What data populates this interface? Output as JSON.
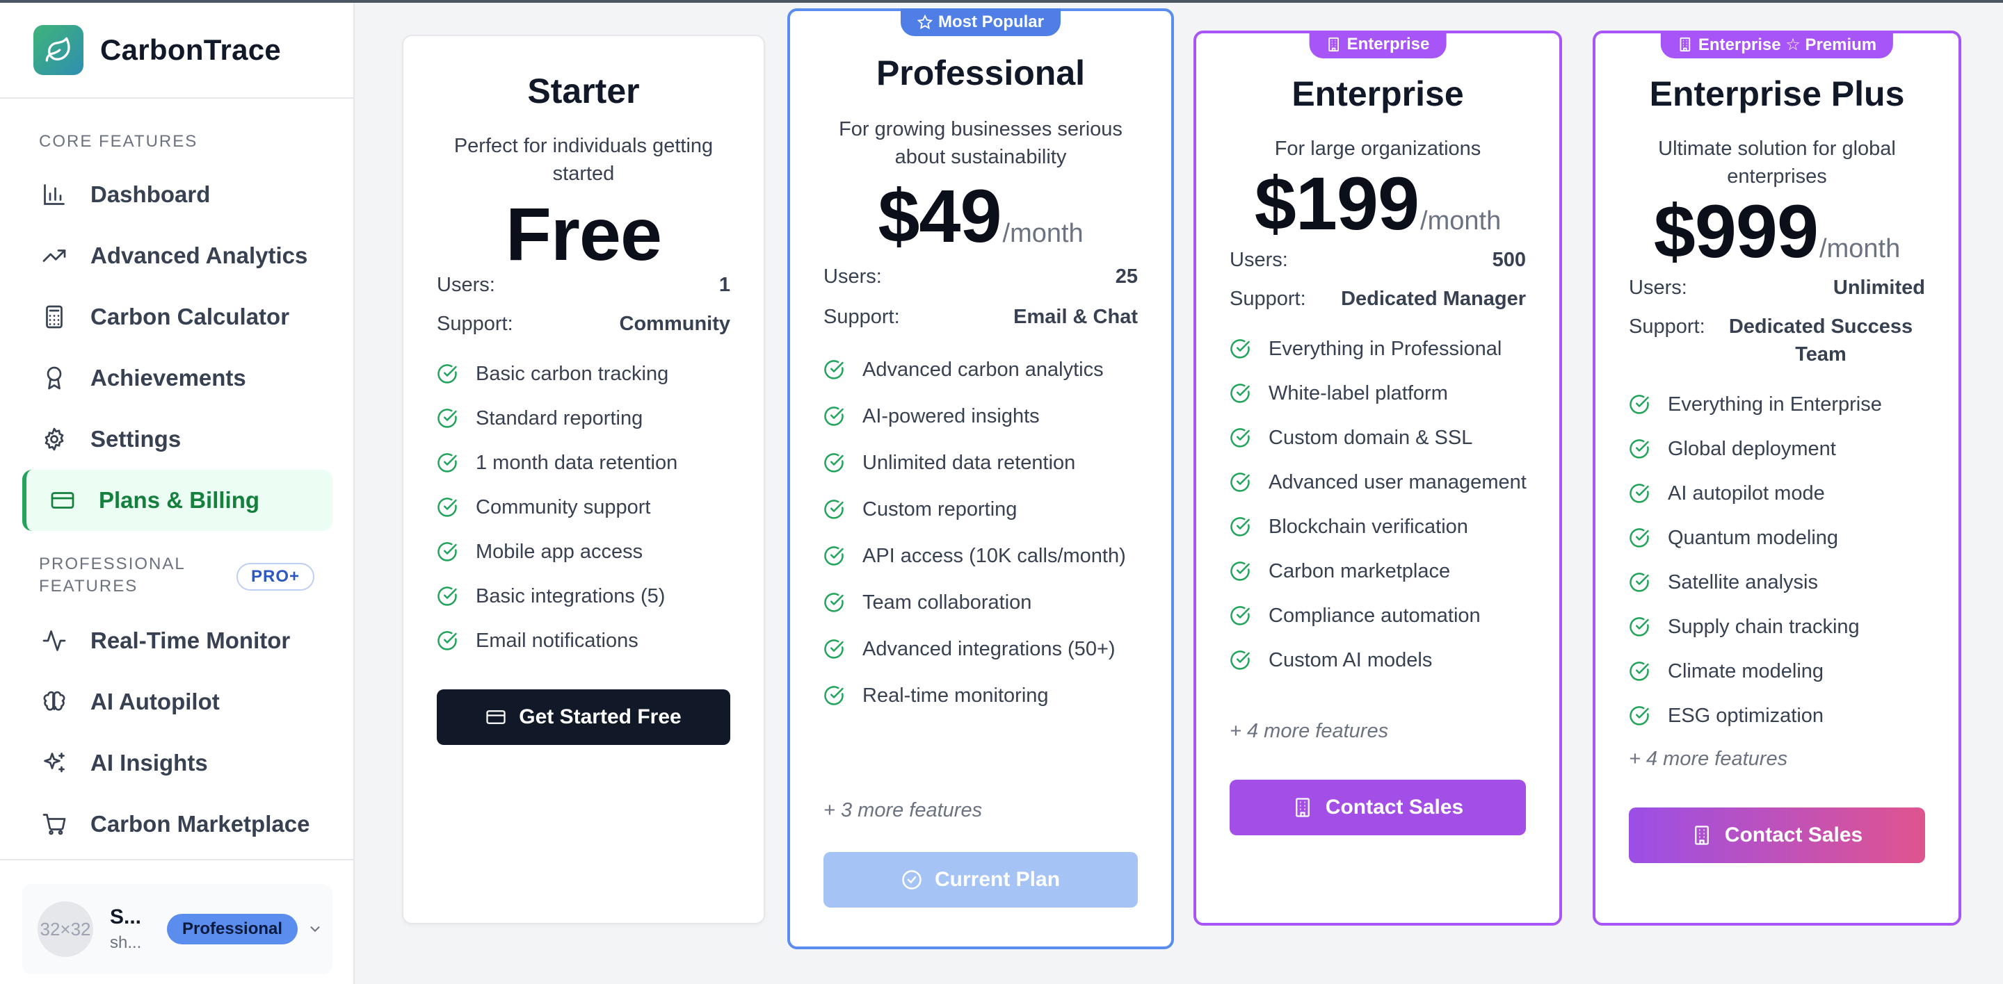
{
  "app": {
    "name": "CarbonTrace"
  },
  "sidebar": {
    "core_label": "CORE FEATURES",
    "core_items": [
      {
        "label": "Dashboard",
        "icon": "bar-chart-icon"
      },
      {
        "label": "Advanced Analytics",
        "icon": "trending-up-icon"
      },
      {
        "label": "Carbon Calculator",
        "icon": "calculator-icon"
      },
      {
        "label": "Achievements",
        "icon": "award-icon"
      },
      {
        "label": "Settings",
        "icon": "gear-icon"
      },
      {
        "label": "Plans & Billing",
        "icon": "credit-card-icon",
        "active": true
      }
    ],
    "pro_label_line1": "PROFESSIONAL",
    "pro_label_line2": "FEATURES",
    "pro_badge": "PRO+",
    "pro_items": [
      {
        "label": "Real-Time Monitor",
        "icon": "activity-icon"
      },
      {
        "label": "AI Autopilot",
        "icon": "brain-icon"
      },
      {
        "label": "AI Insights",
        "icon": "sparkles-icon"
      },
      {
        "label": "Carbon Marketplace",
        "icon": "cart-icon"
      }
    ],
    "user": {
      "avatar_text": "32×32",
      "name": "S...",
      "email": "sh...",
      "plan": "Professional"
    }
  },
  "plans": {
    "starter": {
      "name": "Starter",
      "desc": "Perfect for individuals getting started",
      "price": "Free",
      "users_label": "Users:",
      "users": "1",
      "support_label": "Support:",
      "support": "Community",
      "features": [
        "Basic carbon tracking",
        "Standard reporting",
        "1 month data retention",
        "Community support",
        "Mobile app access",
        "Basic integrations (5)",
        "Email notifications"
      ],
      "cta": "Get Started Free"
    },
    "pro": {
      "badge": "Most Popular",
      "name": "Professional",
      "desc": "For growing businesses serious about sustainability",
      "price": "$49",
      "per": "/month",
      "users_label": "Users:",
      "users": "25",
      "support_label": "Support:",
      "support": "Email & Chat",
      "features": [
        "Advanced carbon analytics",
        "AI-powered insights",
        "Unlimited data retention",
        "Custom reporting",
        "API access (10K calls/month)",
        "Team collaboration",
        "Advanced integrations (50+)",
        "Real-time monitoring"
      ],
      "more": "+ 3 more features",
      "cta": "Current Plan"
    },
    "enterprise": {
      "badge": "Enterprise",
      "name": "Enterprise",
      "desc": "For large organizations",
      "price": "$199",
      "per": "/month",
      "users_label": "Users:",
      "users": "500",
      "support_label": "Support:",
      "support": "Dedicated Manager",
      "features": [
        "Everything in Professional",
        "White-label platform",
        "Custom domain & SSL",
        "Advanced user management",
        "Blockchain verification",
        "Carbon marketplace",
        "Compliance automation",
        "Custom AI models"
      ],
      "more": "+ 4 more features",
      "cta": "Contact Sales"
    },
    "enterprise_plus": {
      "badge": "Enterprise ☆ Premium",
      "name": "Enterprise Plus",
      "desc": "Ultimate solution for global enterprises",
      "price": "$999",
      "per": "/month",
      "users_label": "Users:",
      "users": "Unlimited",
      "support_label": "Support:",
      "support": "Dedicated Success Team",
      "features": [
        "Everything in Enterprise",
        "Global deployment",
        "AI autopilot mode",
        "Quantum modeling",
        "Satellite analysis",
        "Supply chain tracking",
        "Climate modeling",
        "ESG optimization"
      ],
      "more": "+ 4 more features",
      "cta": "Contact Sales"
    }
  },
  "colors": {
    "accent_green": "#22a55b",
    "accent_blue": "#5b8def",
    "accent_purple": "#a855f7"
  }
}
